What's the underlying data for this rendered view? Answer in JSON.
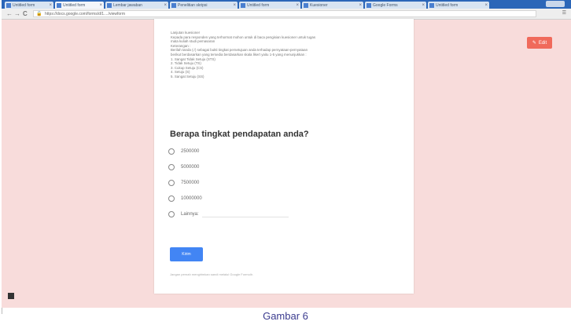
{
  "browser": {
    "tabs": [
      {
        "label": "Untitled form"
      },
      {
        "label": "Untitled form"
      },
      {
        "label": "Lembar jawaban"
      },
      {
        "label": "Penelitian skripsi"
      },
      {
        "label": "Untitled form"
      },
      {
        "label": "Kuesioner"
      },
      {
        "label": "Google Forms"
      },
      {
        "label": "Untitled form"
      }
    ],
    "nav": {
      "back": "←",
      "forward": "→",
      "reload": "C"
    },
    "url": "https://docs.google.com/forms/d/1..../viewform",
    "lock_icon": "lock-icon",
    "menu_icon": "menu-icon"
  },
  "form": {
    "description_lines": [
      "Lanjutan kuesioner",
      "Kepada para responden yang terhormat mohon untuk di baca pengisian kuesioner untuk tugas",
      "mata kuliah studi pemasaran",
      "Keterangan :",
      "Berilah tanda (√) sebagai bukti tingkat persetujuan anda terhadap pernyataan-pernyataan",
      "berikut berdasarkan yang tersedia berdasarkan skala likert yaitu 1-5 yang menunjukkan :",
      "1. Sangat Tidak Setuju (STS)",
      "2. Tidak Setuju (TS)",
      "3. Cukup Setuju (CS)",
      "4. Setuju (S)",
      "5. Sangat Setuju (SS)"
    ],
    "question": "Berapa tingkat pendapatan anda?",
    "options": [
      "2500000",
      "5000000",
      "7500000",
      "10000000"
    ],
    "other_label": "Lainnya:",
    "submit_label": "Kirim",
    "footer_note": "Jangan pernah mengirimkan sandi melalui Google Formulir.",
    "edit_label": "Edit",
    "edit_icon": "pencil-icon"
  },
  "caption": "Gambar 6",
  "colors": {
    "background": "#f8dcdb",
    "accent": "#4285f4",
    "edit_button": "#f06a5b",
    "caption_text": "#3b3b8f"
  }
}
